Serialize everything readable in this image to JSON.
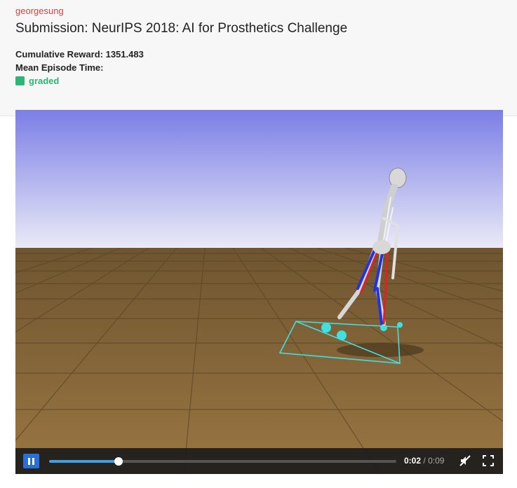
{
  "submission": {
    "username": "georgesung",
    "title": "Submission: NeurIPS 2018: AI for Prosthetics Challenge",
    "cumulative_reward": "Cumulative Reward: 1351.483",
    "mean_episode_time": "Mean Episode Time:",
    "status_label": "graded",
    "status_color": "#2bb673"
  },
  "video": {
    "current_time": "0:02",
    "separator": "/",
    "duration": "0:09",
    "progress_fraction": 0.2,
    "icons": [
      "pause-icon",
      "mute-icon",
      "fullscreen-icon"
    ]
  },
  "colors": {
    "username": "#d0443e",
    "accent": "#2a6fd6",
    "progress": "#3aa0e8",
    "sky_top": "#7b7ee6",
    "sky_bottom": "#eaeaf7",
    "floor": "#8a6a3a"
  }
}
